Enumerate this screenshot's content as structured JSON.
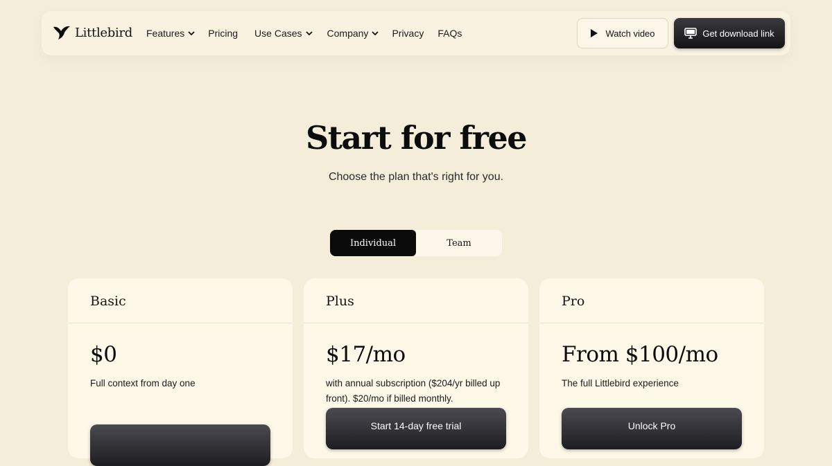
{
  "brand": {
    "name": "Littlebird"
  },
  "nav": {
    "items": [
      {
        "label": "Features",
        "dropdown": true
      },
      {
        "label": "Pricing",
        "dropdown": false
      },
      {
        "label": "Use Cases",
        "dropdown": true
      },
      {
        "label": "Company",
        "dropdown": true
      },
      {
        "label": "Privacy",
        "dropdown": false
      },
      {
        "label": "FAQs",
        "dropdown": false
      }
    ],
    "watch_label": "Watch video",
    "download_label": "Get download link"
  },
  "hero": {
    "title": "Start for free",
    "subtitle": "Choose the plan that's right for you."
  },
  "plan_toggle": {
    "options": [
      "Individual",
      "Team"
    ],
    "selected": "Individual"
  },
  "plans": [
    {
      "name": "Basic",
      "price": "$0",
      "description": "Full context from day one",
      "cta": ""
    },
    {
      "name": "Plus",
      "price": "$17/mo",
      "description": "with annual subscription ($204/yr billed up front). $20/mo if billed monthly.",
      "cta": "Start 14-day free trial"
    },
    {
      "name": "Pro",
      "price": "From $100/mo",
      "description": "The full Littlebird experience",
      "cta": "Unlock Pro"
    }
  ],
  "colors": {
    "background": "#f4edd9",
    "card": "#fdf8e7",
    "primary_dark": "#0b0b0c"
  },
  "icons": {
    "logo": "bird-icon",
    "watch": "play-icon",
    "download": "monitor-icon",
    "dropdown": "chevron-down-icon"
  }
}
